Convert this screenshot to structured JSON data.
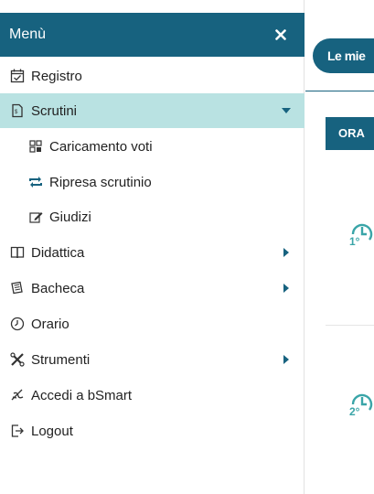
{
  "menu": {
    "title": "Menù",
    "items": [
      {
        "label": "Registro",
        "icon": "calendar-check-icon"
      },
      {
        "label": "Scrutini",
        "icon": "document-icon",
        "active": true
      },
      {
        "label": "Caricamento voti",
        "icon": "grid-icon"
      },
      {
        "label": "Ripresa scrutinio",
        "icon": "repeat-icon"
      },
      {
        "label": "Giudizi",
        "icon": "pencil-square-icon"
      },
      {
        "label": "Didattica",
        "icon": "book-icon"
      },
      {
        "label": "Bacheca",
        "icon": "newspaper-icon"
      },
      {
        "label": "Orario",
        "icon": "clock-icon"
      },
      {
        "label": "Strumenti",
        "icon": "tools-icon"
      },
      {
        "label": "Accedi a bSmart",
        "icon": "signature-icon"
      },
      {
        "label": "Logout",
        "icon": "logout-icon"
      }
    ]
  },
  "content": {
    "pill_label": "Le mie",
    "tab_label": "ORA",
    "slots": [
      "1°",
      "2°"
    ]
  },
  "colors": {
    "primary": "#17627f",
    "active_bg": "#b9e2e2",
    "icon_teal": "#3aa5a8"
  }
}
